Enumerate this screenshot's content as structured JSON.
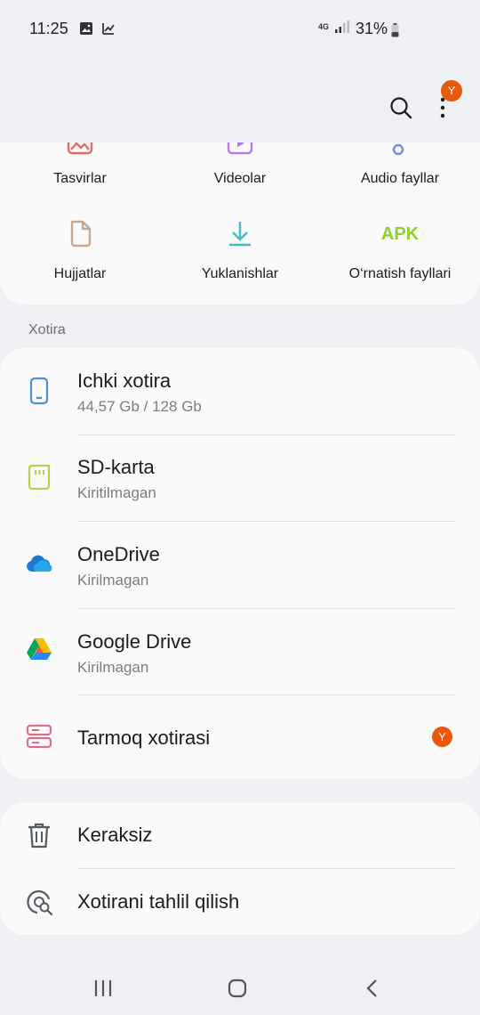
{
  "status": {
    "time": "11:25",
    "network": "4G",
    "battery": "31%",
    "left_icons": [
      "image-notification-icon",
      "chart-notification-icon"
    ]
  },
  "appbar": {
    "avatar_letter": "Y",
    "search_icon": "search-icon",
    "more_icon": "more-vert-icon"
  },
  "categories": [
    {
      "label": "Tasvirlar",
      "icon": "image-icon",
      "color": "#e46b6b"
    },
    {
      "label": "Videolar",
      "icon": "video-icon",
      "color": "#b77be0"
    },
    {
      "label": "Audio fayllar",
      "icon": "audio-icon",
      "color": "#6b8fe0"
    },
    {
      "label": "Hujjatlar",
      "icon": "document-icon",
      "color": "#c9a78a"
    },
    {
      "label": "Yuklanishlar",
      "icon": "download-icon",
      "color": "#3fbcc7"
    },
    {
      "label": "O‘rnatish fayllari",
      "icon": "apk-icon",
      "icon_text": "APK",
      "color": "#8fcf2e"
    }
  ],
  "storage_section_label": "Xotira",
  "storage": [
    {
      "title": "Ichki xotira",
      "subtitle": "44,57 Gb / 128 Gb",
      "icon": "phone-icon",
      "color": "#4a90d9"
    },
    {
      "title": "SD-karta",
      "subtitle": "Kiritilmagan",
      "icon": "sd-card-icon",
      "color": "#b5d04a"
    },
    {
      "title": "OneDrive",
      "subtitle": "Kirilmagan",
      "icon": "onedrive-icon",
      "color": "#1e78d4"
    },
    {
      "title": "Google Drive",
      "subtitle": "Kirilmagan",
      "icon": "google-drive-icon",
      "color": "#34a853"
    },
    {
      "title": "Tarmoq xotirasi",
      "badge": "Y",
      "icon": "network-storage-icon",
      "color": "#e06b8a"
    }
  ],
  "utilities": [
    {
      "title": "Keraksiz",
      "icon": "trash-icon"
    },
    {
      "title": "Xotirani tahlil qilish",
      "icon": "storage-analysis-icon"
    }
  ],
  "navbar": [
    "recents-icon",
    "home-icon",
    "back-icon"
  ]
}
